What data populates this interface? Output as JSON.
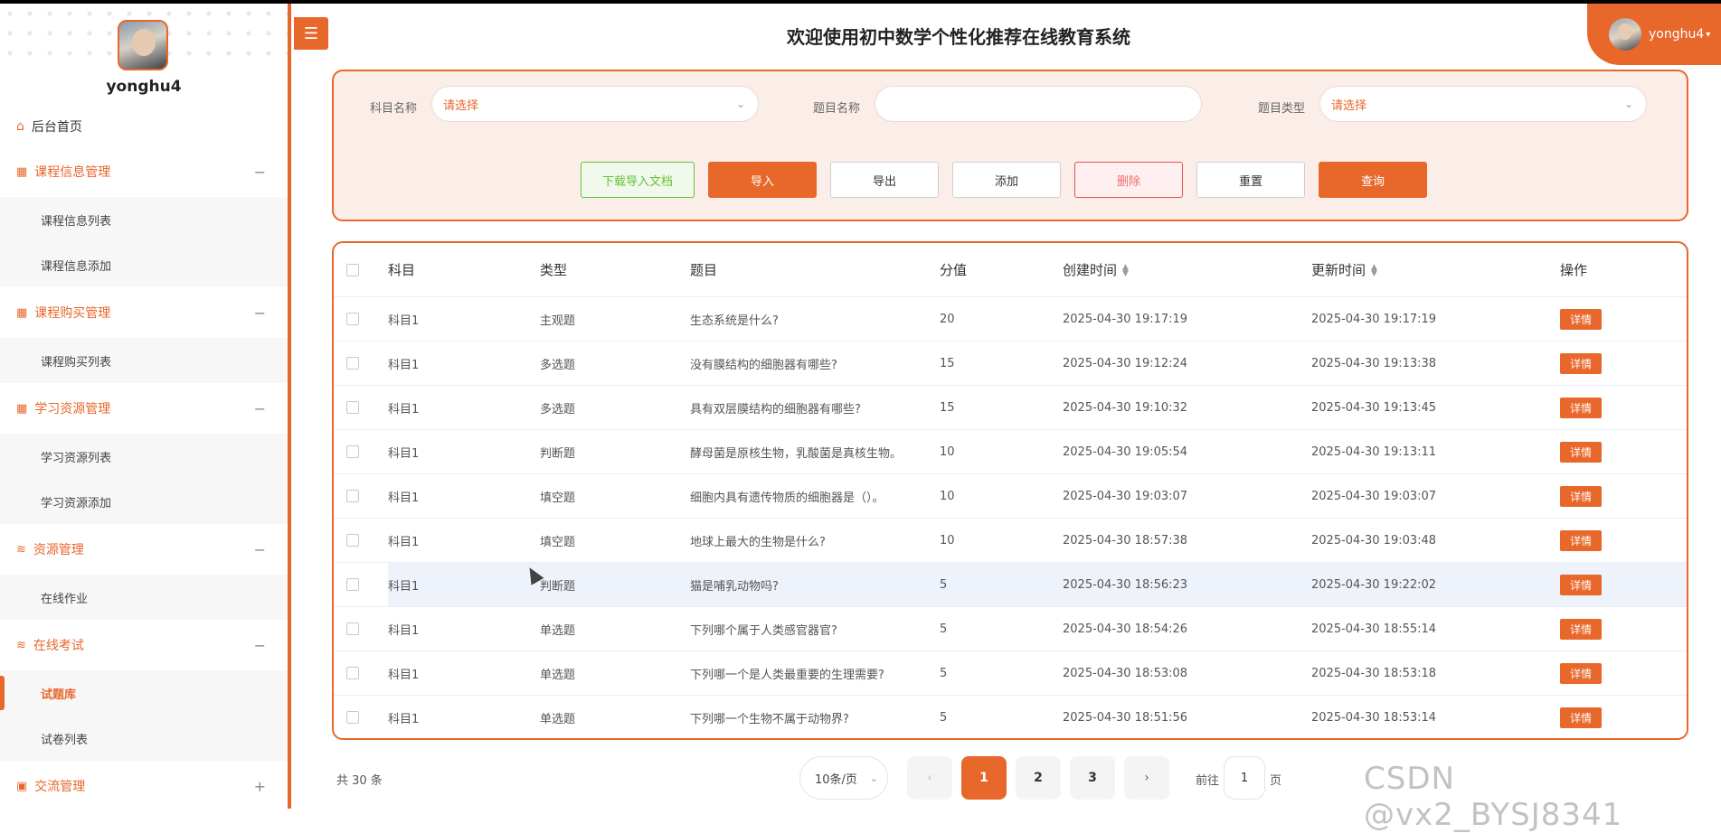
{
  "app": {
    "title": "欢迎使用初中数学个性化推荐在线教育系统",
    "username": "yonghu4"
  },
  "sidebar": {
    "username": "yonghu4",
    "home": "后台首页",
    "groups": [
      {
        "label": "课程信息管理",
        "toggle": "−",
        "items": [
          "课程信息列表",
          "课程信息添加"
        ]
      },
      {
        "label": "课程购买管理",
        "toggle": "−",
        "items": [
          "课程购买列表"
        ]
      },
      {
        "label": "学习资源管理",
        "toggle": "−",
        "items": [
          "学习资源列表",
          "学习资源添加"
        ]
      },
      {
        "label": "资源管理",
        "toggle": "−",
        "items": [
          "在线作业"
        ]
      },
      {
        "label": "在线考试",
        "toggle": "−",
        "items": [
          "试题库",
          "试卷列表"
        ]
      },
      {
        "label": "交流管理",
        "toggle": "+",
        "items": []
      }
    ],
    "active_item": "试题库"
  },
  "search": {
    "subject_label": "科目名称",
    "subject_placeholder": "请选择",
    "question_label": "题目名称",
    "question_value": "",
    "type_label": "题目类型",
    "type_placeholder": "请选择"
  },
  "toolbar": {
    "download": "下载导入文档",
    "import": "导入",
    "export": "导出",
    "add": "添加",
    "delete": "删除",
    "reset": "重置",
    "query": "查询"
  },
  "table": {
    "headers": {
      "subject": "科目",
      "type": "类型",
      "question": "题目",
      "score": "分值",
      "created": "创建时间",
      "updated": "更新时间",
      "operation": "操作"
    },
    "detail_label": "详情",
    "rows": [
      {
        "subject": "科目1",
        "type": "主观题",
        "question": "生态系统是什么?",
        "score": "20",
        "created": "2025-04-30 19:17:19",
        "updated": "2025-04-30 19:17:19"
      },
      {
        "subject": "科目1",
        "type": "多选题",
        "question": "没有膜结构的细胞器有哪些?",
        "score": "15",
        "created": "2025-04-30 19:12:24",
        "updated": "2025-04-30 19:13:38"
      },
      {
        "subject": "科目1",
        "type": "多选题",
        "question": "具有双层膜结构的细胞器有哪些?",
        "score": "15",
        "created": "2025-04-30 19:10:32",
        "updated": "2025-04-30 19:13:45"
      },
      {
        "subject": "科目1",
        "type": "判断题",
        "question": "酵母菌是原核生物，乳酸菌是真核生物。",
        "score": "10",
        "created": "2025-04-30 19:05:54",
        "updated": "2025-04-30 19:13:11"
      },
      {
        "subject": "科目1",
        "type": "填空题",
        "question": "细胞内具有遗传物质的细胞器是（）。",
        "score": "10",
        "created": "2025-04-30 19:03:07",
        "updated": "2025-04-30 19:03:07"
      },
      {
        "subject": "科目1",
        "type": "填空题",
        "question": "地球上最大的生物是什么?",
        "score": "10",
        "created": "2025-04-30 18:57:38",
        "updated": "2025-04-30 19:03:48"
      },
      {
        "subject": "科目1",
        "type": "判断题",
        "question": "猫是哺乳动物吗?",
        "score": "5",
        "created": "2025-04-30 18:56:23",
        "updated": "2025-04-30 19:22:02"
      },
      {
        "subject": "科目1",
        "type": "单选题",
        "question": "下列哪个属于人类感官器官?",
        "score": "5",
        "created": "2025-04-30 18:54:26",
        "updated": "2025-04-30 18:55:14"
      },
      {
        "subject": "科目1",
        "type": "单选题",
        "question": "下列哪一个是人类最重要的生理需要?",
        "score": "5",
        "created": "2025-04-30 18:53:08",
        "updated": "2025-04-30 18:53:18"
      },
      {
        "subject": "科目1",
        "type": "单选题",
        "question": "下列哪一个生物不属于动物界?",
        "score": "5",
        "created": "2025-04-30 18:51:56",
        "updated": "2025-04-30 18:53:14"
      }
    ]
  },
  "pagination": {
    "total": "共 30 条",
    "page_size": "10条/页",
    "pages": [
      "1",
      "2",
      "3"
    ],
    "prev": "‹",
    "next": "›",
    "goto_prefix": "前往",
    "goto_value": "1",
    "goto_suffix": "页"
  },
  "watermark": "CSDN @vx2_BYSJ8341",
  "colors": {
    "accent": "#e8672b",
    "download": "#67c23a",
    "danger": "#f56c6c"
  }
}
